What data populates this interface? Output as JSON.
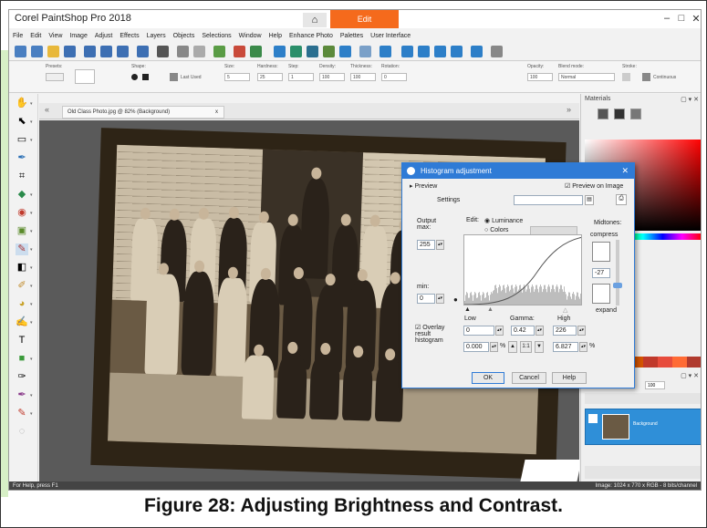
{
  "app": {
    "title": "Corel PaintShop Pro 2018",
    "home_icon": "home-icon",
    "edit_tab": "Edit",
    "win_minimize": "–",
    "win_maximize": "□",
    "win_close": "✕"
  },
  "menu": [
    "File",
    "Edit",
    "View",
    "Image",
    "Adjust",
    "Effects",
    "Layers",
    "Objects",
    "Selections",
    "Window",
    "Help",
    "Enhance Photo",
    "Palettes",
    "User Interface"
  ],
  "options": {
    "presets_label": "Presets:",
    "shape_label": "Shape:",
    "last_used": "Last Used",
    "size_label": "Size:",
    "size_value": "5",
    "hardness_label": "Hardness:",
    "hardness_value": "25",
    "step_label": "Step:",
    "step_value": "1",
    "density_label": "Density:",
    "density_value": "100",
    "thickness_label": "Thickness:",
    "thickness_value": "100",
    "rotation_label": "Rotation:",
    "rotation_value": "0",
    "opacity_label": "Opacity:",
    "opacity_value": "100",
    "blend_label": "Blend mode:",
    "blend_value": "Normal",
    "stroke_label": "Stroke:",
    "continuous": "Continuous"
  },
  "doc_tab": "Old Class Photo.jpg @ 82% (Background)",
  "doc_tab_close": "x",
  "materials": {
    "title": "Materials",
    "controls": "▢ ▾ ✕"
  },
  "layers": {
    "controls": "▢ ▾ ✕",
    "zoom_value": "100",
    "layer_name": "Background"
  },
  "status": {
    "left": "For Help, press F1",
    "right": "Image: 1024 x 770 x RGB - 8 bits/channel"
  },
  "dialog": {
    "title": "Histogram adjustment",
    "preview": "Preview",
    "preview_on_image": "Preview on Image",
    "settings": "Settings",
    "edit_label": "Edit:",
    "luminance": "Luminance",
    "colors": "Colors",
    "midtones": "Midtones:",
    "compress": "compress",
    "expand": "expand",
    "midtone_value": "-27",
    "output_max_label": "Output max:",
    "output_max_value": "255",
    "min_label": "min:",
    "min_value": "0",
    "low_label": "Low",
    "gamma_label": "Gamma:",
    "high_label": "High",
    "low_value": "0",
    "gamma_value": "0.42",
    "high_value": "226",
    "low_pct": "0.000",
    "high_pct": "6.827",
    "pct_sign": "%",
    "one_to_one": "1:1",
    "overlay": "Overlay result histogram",
    "ok": "OK",
    "cancel": "Cancel",
    "help": "Help"
  },
  "caption": "Figure 28: Adjusting Brightness and Contrast."
}
